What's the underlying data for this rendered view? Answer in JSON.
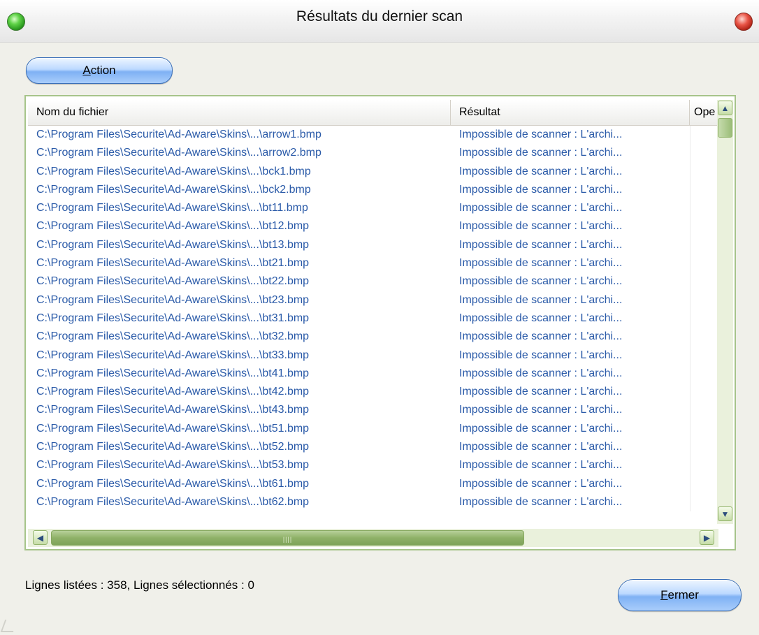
{
  "window": {
    "title": "Résultats du dernier scan"
  },
  "toolbar": {
    "action_label_ul": "A",
    "action_label_rest": "ction"
  },
  "table": {
    "headers": [
      "Nom du fichier",
      "Résultat",
      "Ope"
    ],
    "rows": [
      {
        "file": "C:\\Program Files\\Securite\\Ad-Aware\\Skins\\...\\arrow1.bmp",
        "result": "Impossible de scanner : L'archi..."
      },
      {
        "file": "C:\\Program Files\\Securite\\Ad-Aware\\Skins\\...\\arrow2.bmp",
        "result": "Impossible de scanner : L'archi..."
      },
      {
        "file": "C:\\Program Files\\Securite\\Ad-Aware\\Skins\\...\\bck1.bmp",
        "result": "Impossible de scanner : L'archi..."
      },
      {
        "file": "C:\\Program Files\\Securite\\Ad-Aware\\Skins\\...\\bck2.bmp",
        "result": "Impossible de scanner : L'archi..."
      },
      {
        "file": "C:\\Program Files\\Securite\\Ad-Aware\\Skins\\...\\bt11.bmp",
        "result": "Impossible de scanner : L'archi..."
      },
      {
        "file": "C:\\Program Files\\Securite\\Ad-Aware\\Skins\\...\\bt12.bmp",
        "result": "Impossible de scanner : L'archi..."
      },
      {
        "file": "C:\\Program Files\\Securite\\Ad-Aware\\Skins\\...\\bt13.bmp",
        "result": "Impossible de scanner : L'archi..."
      },
      {
        "file": "C:\\Program Files\\Securite\\Ad-Aware\\Skins\\...\\bt21.bmp",
        "result": "Impossible de scanner : L'archi..."
      },
      {
        "file": "C:\\Program Files\\Securite\\Ad-Aware\\Skins\\...\\bt22.bmp",
        "result": "Impossible de scanner : L'archi..."
      },
      {
        "file": "C:\\Program Files\\Securite\\Ad-Aware\\Skins\\...\\bt23.bmp",
        "result": "Impossible de scanner : L'archi..."
      },
      {
        "file": "C:\\Program Files\\Securite\\Ad-Aware\\Skins\\...\\bt31.bmp",
        "result": "Impossible de scanner : L'archi..."
      },
      {
        "file": "C:\\Program Files\\Securite\\Ad-Aware\\Skins\\...\\bt32.bmp",
        "result": "Impossible de scanner : L'archi..."
      },
      {
        "file": "C:\\Program Files\\Securite\\Ad-Aware\\Skins\\...\\bt33.bmp",
        "result": "Impossible de scanner : L'archi..."
      },
      {
        "file": "C:\\Program Files\\Securite\\Ad-Aware\\Skins\\...\\bt41.bmp",
        "result": "Impossible de scanner : L'archi..."
      },
      {
        "file": "C:\\Program Files\\Securite\\Ad-Aware\\Skins\\...\\bt42.bmp",
        "result": "Impossible de scanner : L'archi..."
      },
      {
        "file": "C:\\Program Files\\Securite\\Ad-Aware\\Skins\\...\\bt43.bmp",
        "result": "Impossible de scanner : L'archi..."
      },
      {
        "file": "C:\\Program Files\\Securite\\Ad-Aware\\Skins\\...\\bt51.bmp",
        "result": "Impossible de scanner : L'archi..."
      },
      {
        "file": "C:\\Program Files\\Securite\\Ad-Aware\\Skins\\...\\bt52.bmp",
        "result": "Impossible de scanner : L'archi..."
      },
      {
        "file": "C:\\Program Files\\Securite\\Ad-Aware\\Skins\\...\\bt53.bmp",
        "result": "Impossible de scanner : L'archi..."
      },
      {
        "file": "C:\\Program Files\\Securite\\Ad-Aware\\Skins\\...\\bt61.bmp",
        "result": "Impossible de scanner : L'archi..."
      },
      {
        "file": "C:\\Program Files\\Securite\\Ad-Aware\\Skins\\...\\bt62.bmp",
        "result": "Impossible de scanner : L'archi..."
      }
    ]
  },
  "status": {
    "text": "Lignes listées : 358,  Lignes sélectionnés : 0"
  },
  "footer": {
    "close_label_ul": "F",
    "close_label_rest": "ermer"
  },
  "icons": {
    "minimize": "green-orb-icon",
    "close": "red-orb-icon",
    "scroll_up": "chevron-up-icon",
    "scroll_down": "chevron-down-icon",
    "scroll_left": "chevron-left-icon",
    "scroll_right": "chevron-right-icon"
  },
  "colors": {
    "row_text": "#2a5aa8",
    "frame_border": "#a6c48a",
    "button_blue": "#7fb1f4"
  }
}
